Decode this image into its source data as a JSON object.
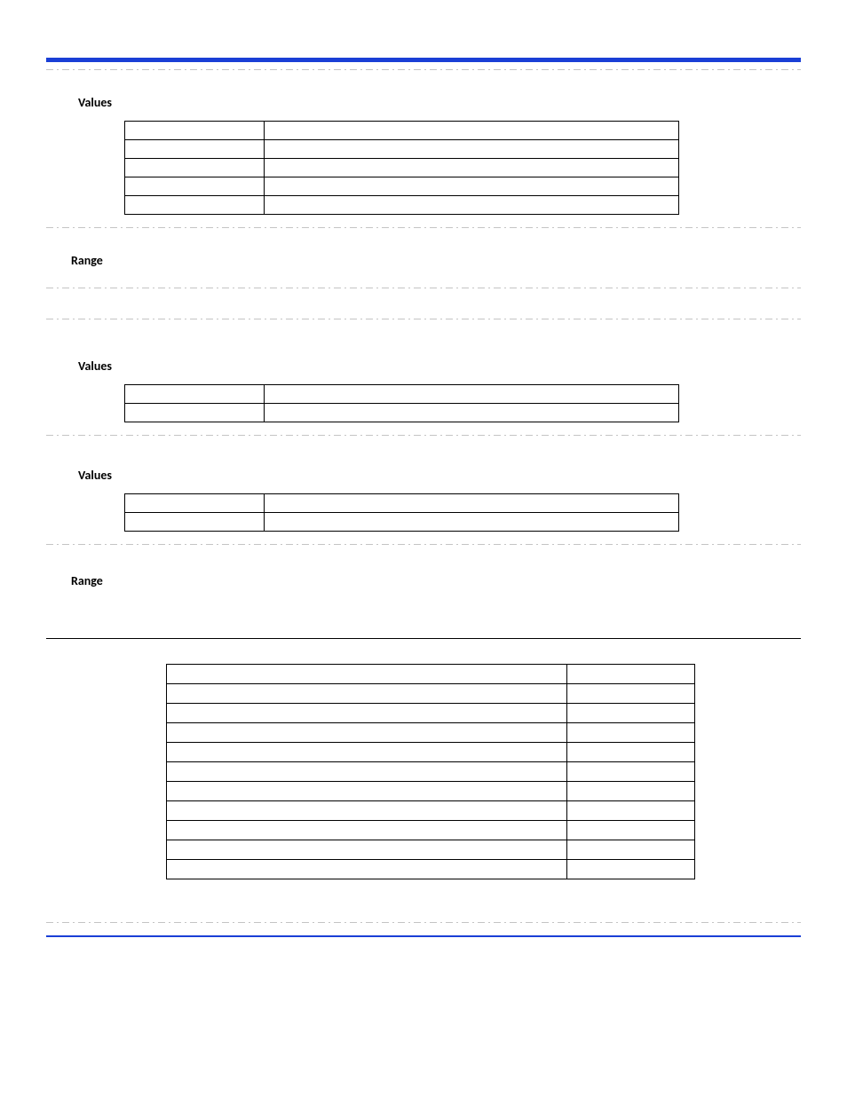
{
  "labels": {
    "values": "Values",
    "range": "Range"
  },
  "sectionA": {
    "label": "values",
    "rows": [
      {
        "c1": "",
        "c2": ""
      },
      {
        "c1": "",
        "c2": ""
      },
      {
        "c1": "",
        "c2": ""
      },
      {
        "c1": "",
        "c2": ""
      },
      {
        "c1": "",
        "c2": ""
      }
    ]
  },
  "sectionB": {
    "label": "range"
  },
  "sectionC": {
    "label": "values",
    "rows": [
      {
        "c1": "",
        "c2": ""
      },
      {
        "c1": "",
        "c2": ""
      }
    ]
  },
  "sectionD": {
    "label": "values",
    "rows": [
      {
        "c1": "",
        "c2": ""
      },
      {
        "c1": "",
        "c2": ""
      }
    ]
  },
  "sectionE": {
    "label": "range"
  },
  "bigTable": {
    "rows": [
      {
        "c1": "",
        "c2": ""
      },
      {
        "c1": "",
        "c2": ""
      },
      {
        "c1": "",
        "c2": ""
      },
      {
        "c1": "",
        "c2": ""
      },
      {
        "c1": "",
        "c2": ""
      },
      {
        "c1": "",
        "c2": ""
      },
      {
        "c1": "",
        "c2": ""
      },
      {
        "c1": "",
        "c2": ""
      },
      {
        "c1": "",
        "c2": ""
      },
      {
        "c1": "",
        "c2": ""
      },
      {
        "c1": "",
        "c2": ""
      }
    ]
  }
}
